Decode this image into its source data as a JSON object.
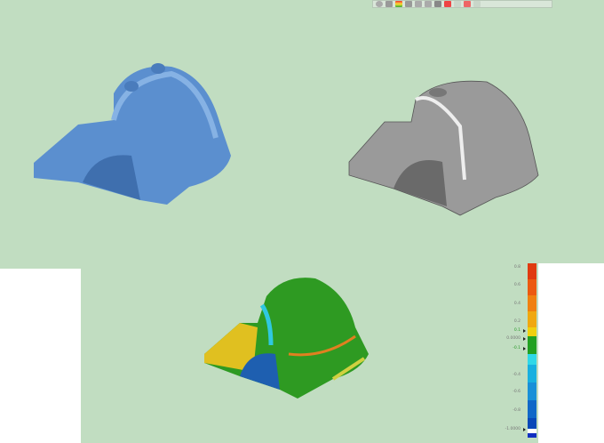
{
  "toolbar": {
    "icons": [
      "zoom-fit-icon",
      "view-orientation-icon",
      "display-style-icon",
      "section-view-icon",
      "hide-show-icon",
      "edit-appearance-icon",
      "scene-icon",
      "apply-scene-icon",
      "render-icon",
      "deviation-icon",
      "settings-icon"
    ]
  },
  "colors": {
    "background": "#c1ddc1",
    "model_blue": "#5b8fcf",
    "model_gray": "#9a9a9a",
    "model_green": "#2e9a22"
  },
  "legend": {
    "labels": [
      {
        "text": "0.8",
        "green": false
      },
      {
        "text": "0.6",
        "green": false
      },
      {
        "text": "0.4",
        "green": false
      },
      {
        "text": "0.2",
        "green": false
      },
      {
        "text": "0.1",
        "green": true
      },
      {
        "text": "0.0000",
        "green": false
      },
      {
        "text": "-0.1",
        "green": true
      },
      {
        "text": "-0.4",
        "green": false
      },
      {
        "text": "-0.6",
        "green": false
      },
      {
        "text": "-0.8",
        "green": false
      },
      {
        "text": "-1.0000",
        "green": false
      }
    ],
    "max": 0.8,
    "min": -1.0
  }
}
